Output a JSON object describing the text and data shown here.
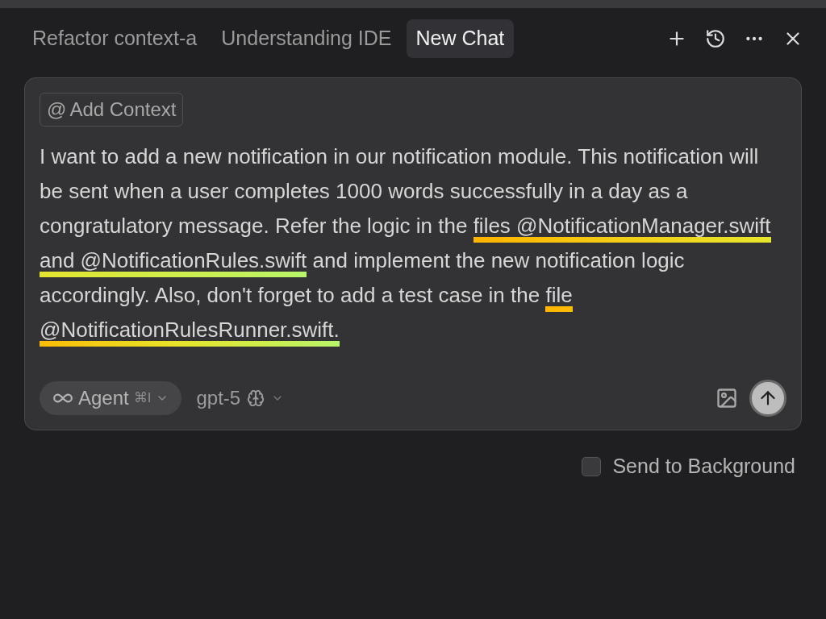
{
  "tabs": [
    {
      "label": "Refactor context-a",
      "selected": false
    },
    {
      "label": "Understanding IDE",
      "selected": false
    },
    {
      "label": "New Chat",
      "selected": true
    }
  ],
  "composer": {
    "context_button": "Add Context",
    "context_symbol": "@",
    "message": [
      {
        "text": "I want to add a new notification in our notification module. This notification will be sent when a user completes 1000 words successfully in a day as a congratulatory message. Refer the logic in the ",
        "underlined": false
      },
      {
        "text": "files @NotificationManager.swift and @NotificationRules.swift",
        "underlined": true
      },
      {
        "text": " and implement the new notification logic accordingly. Also, don't forget to add a test case in the ",
        "underlined": false
      },
      {
        "text": "file @NotificationRulesRunner.swift.",
        "underlined": true
      }
    ],
    "mode": {
      "label": "Agent",
      "shortcut": "⌘I"
    },
    "model": {
      "label": "gpt-5"
    }
  },
  "send_to_background": {
    "label": "Send to Background",
    "checked": false
  }
}
